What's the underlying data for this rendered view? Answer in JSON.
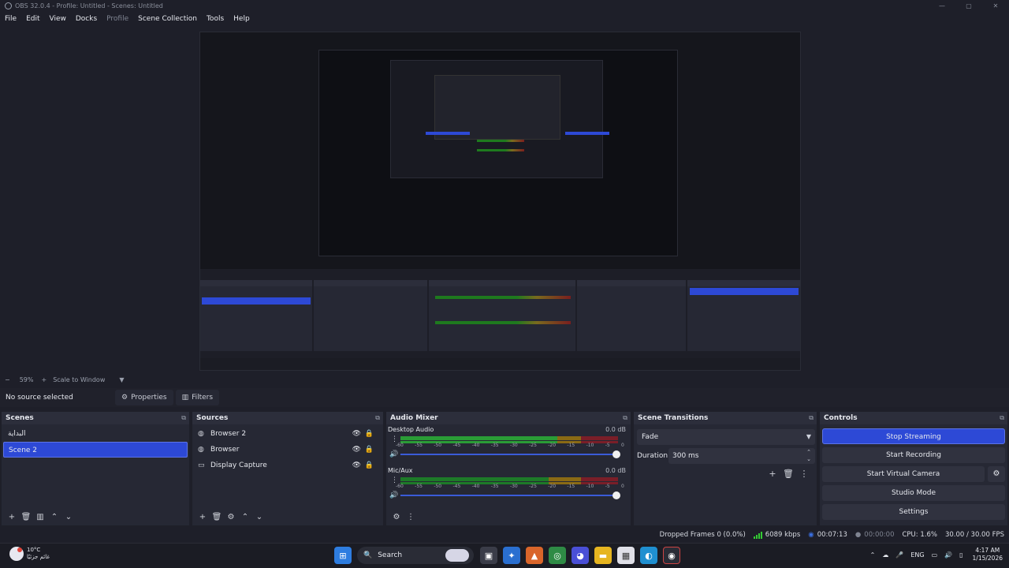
{
  "window": {
    "title": "OBS 32.0.4 - Profile: Untitled - Scenes: Untitled",
    "controls": [
      "—",
      "▢",
      "✕"
    ]
  },
  "menu": {
    "items": [
      {
        "label": "File",
        "enabled": true
      },
      {
        "label": "Edit",
        "enabled": true
      },
      {
        "label": "View",
        "enabled": true
      },
      {
        "label": "Docks",
        "enabled": true
      },
      {
        "label": "Profile",
        "enabled": false
      },
      {
        "label": "Scene Collection",
        "enabled": true
      },
      {
        "label": "Tools",
        "enabled": true
      },
      {
        "label": "Help",
        "enabled": true
      }
    ]
  },
  "zoom": {
    "minus": "−",
    "value": "59%",
    "plus": "+",
    "mode": "Scale to Window",
    "arrow": "▼"
  },
  "source_toolbar": {
    "no_source": "No source selected",
    "properties": "Properties",
    "filters": "Filters"
  },
  "scenes": {
    "title": "Scenes",
    "items": [
      {
        "label": "البداية",
        "active": false
      },
      {
        "label": "Scene 2",
        "active": true
      }
    ]
  },
  "sources": {
    "title": "Sources",
    "items": [
      {
        "label": "Browser 2",
        "icon": "globe-icon"
      },
      {
        "label": "Browser",
        "icon": "globe-icon"
      },
      {
        "label": "Display Capture",
        "icon": "monitor-icon"
      }
    ]
  },
  "audio_mixer": {
    "title": "Audio Mixer",
    "ticks": [
      "-60",
      "-55",
      "-50",
      "-45",
      "-40",
      "-35",
      "-30",
      "-25",
      "-20",
      "-15",
      "-10",
      "-5",
      "0"
    ],
    "channels": [
      {
        "name": "Desktop Audio",
        "db": "0.0 dB",
        "level": 0.72,
        "volume": 1.0
      },
      {
        "name": "Mic/Aux",
        "db": "0.0 dB",
        "level": 0.0,
        "volume": 1.0
      }
    ]
  },
  "transitions": {
    "title": "Scene Transitions",
    "selected": "Fade",
    "duration_label": "Duration",
    "duration_value": "300 ms"
  },
  "controls": {
    "title": "Controls",
    "stop_streaming": "Stop Streaming",
    "start_recording": "Start Recording",
    "start_virtual_camera": "Start Virtual Camera",
    "studio_mode": "Studio Mode",
    "settings": "Settings"
  },
  "status": {
    "dropped_frames": "Dropped Frames 0 (0.0%)",
    "bitrate": "6089 kbps",
    "stream_time": "00:07:13",
    "record_time": "00:00:00",
    "cpu": "CPU: 1.6%",
    "fps": "30.00 / 30.00 FPS"
  },
  "taskbar": {
    "temp": "10°C",
    "weather_text": "غائم جزئيًا",
    "search": "Search",
    "lang": "ENG",
    "time": "4:17 AM",
    "date": "1/15/2026"
  },
  "colors": {
    "accent": "#2d49d6",
    "panel": "#262834",
    "background": "#1e1f29"
  }
}
